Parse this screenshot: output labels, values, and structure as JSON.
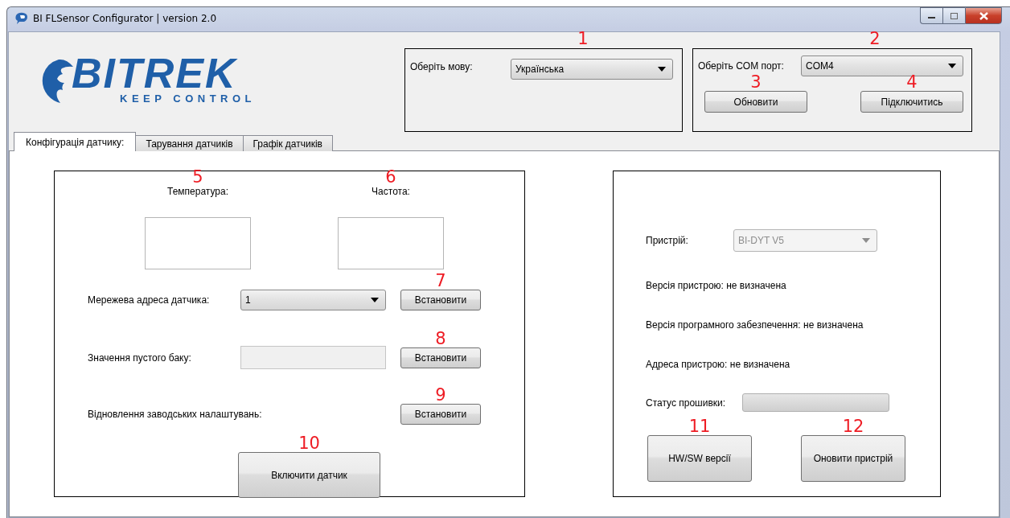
{
  "window": {
    "title": "BI FLSensor Configurator | version 2.0"
  },
  "logo": {
    "wordmark": "BITREK",
    "tagline": "KEEP CONTROL"
  },
  "language": {
    "label": "Оберіть мову:",
    "value": "Українська",
    "marker": "1"
  },
  "com": {
    "label": "Оберіть COM порт:",
    "value": "COM4",
    "marker": "2",
    "buttons": [
      {
        "label": "Обновити",
        "marker": "3"
      },
      {
        "label": "Підключитись",
        "marker": "4"
      }
    ]
  },
  "tabs": [
    {
      "label": "Конфігурація датчику:",
      "selected": true
    },
    {
      "label": "Тарування датчиків",
      "selected": false
    },
    {
      "label": "Графік датчиків",
      "selected": false
    }
  ],
  "sensor": {
    "readouts": [
      {
        "label": "Температура:",
        "marker": "5"
      },
      {
        "label": "Частота:",
        "marker": "6"
      }
    ],
    "rows": [
      {
        "kind": "select",
        "label": "Мережева адреса датчика:",
        "value": "1",
        "button": "Встановити",
        "marker": "7"
      },
      {
        "kind": "field",
        "label": "Значення пустого баку:",
        "disabled": true,
        "button": "Встановити",
        "marker": "8"
      },
      {
        "kind": "plain",
        "label": "Відновлення заводських налаштувань:",
        "button": "Встановити",
        "marker": "9"
      }
    ],
    "enable_button": {
      "label": "Включити датчик",
      "marker": "10"
    }
  },
  "device": {
    "label": "Пристрій:",
    "value": "BI-DYT V5",
    "disabled": true,
    "info": [
      "Версія пристрою: не визначена",
      "Версія програмного забезпечення: не визначена",
      "Адреса пристрою: не визначена"
    ],
    "firmware": {
      "label": "Статус прошивки:",
      "level": 0
    },
    "buttons": [
      {
        "label": "HW/SW версії",
        "marker": "11"
      },
      {
        "label": "Оновити пристрій",
        "marker": "12"
      }
    ]
  }
}
